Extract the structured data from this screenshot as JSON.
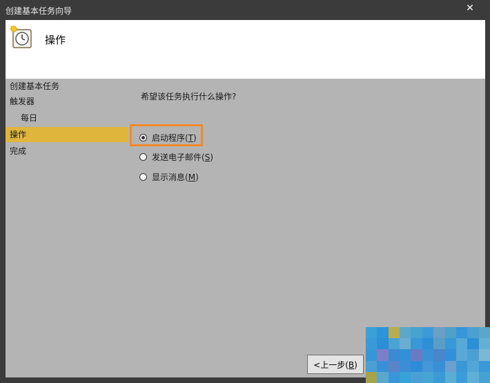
{
  "window": {
    "title": "创建基本任务向导",
    "close_glyph": "✕"
  },
  "header": {
    "heading": "操作"
  },
  "nav": {
    "items": [
      {
        "label": "创建基本任务"
      },
      {
        "label": "触发器"
      },
      {
        "label": "每日"
      },
      {
        "label": "操作"
      },
      {
        "label": "完成"
      }
    ],
    "active": "操作"
  },
  "main": {
    "question": "希望该任务执行什么操作?",
    "options": [
      {
        "label": "启动程序",
        "mnemonic": "T",
        "checked": true
      },
      {
        "label": "发送电子邮件",
        "mnemonic": "S",
        "checked": false
      },
      {
        "label": "显示消息",
        "mnemonic": "M",
        "checked": false
      }
    ]
  },
  "buttons": {
    "back_label": "<上一步",
    "back_mnemonic": "B"
  },
  "colors": {
    "titlebar": "#3b3b3b",
    "content_bg": "#b4b4b4",
    "active_nav": "#e0b53c",
    "highlight_border": "#f08a2a"
  },
  "overlay_pixels": [
    "#3ba0d8",
    "#2f95d8",
    "#b8ad4e",
    "#5ba8c8",
    "#47a2d0",
    "#3c9ad6",
    "#6a9fc8",
    "#4fa1c9",
    "#3596d8",
    "#4aa0d0",
    "#5aa6cc",
    "#3a9ad8",
    "#2c8ed6",
    "#4aa3d3",
    "#6aaed2",
    "#3a97d8",
    "#2f8fd6",
    "#5a9ec8",
    "#3898d8",
    "#57a9d6",
    "#2d8fd5",
    "#62b0d6",
    "#3696d8",
    "#7a7fc8",
    "#3b8ad4",
    "#3290d6",
    "#6a7ac4",
    "#3a92d6",
    "#4a86cc",
    "#3390d8",
    "#5aa8d6",
    "#4aa0d2",
    "#7ab8d6",
    "#4a9ed4",
    "#3a90d6",
    "#5a84c8",
    "#3b8ed6",
    "#2e8cd6",
    "#4396d8",
    "#3790d6",
    "#6aa0d0",
    "#3898d8",
    "#52a6d6",
    "#3a98d8",
    "#a6a44a",
    "#5aa8d0",
    "#3996d8",
    "#36a2d6",
    "#4aa0d4",
    "#48a4d4",
    "#3a9ad8",
    "#5aaed6",
    "#3a9cd8",
    "#60b0d6",
    "#46a2d4"
  ]
}
